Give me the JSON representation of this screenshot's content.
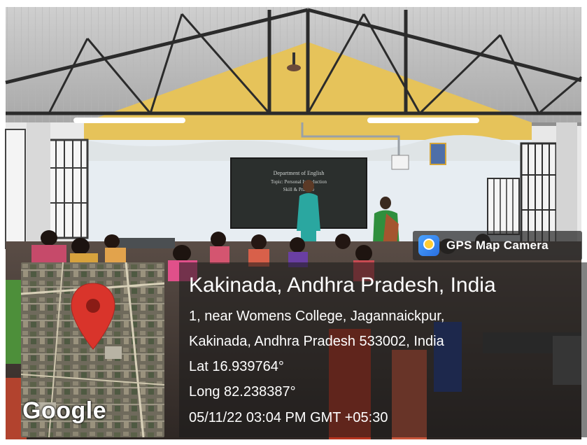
{
  "watermark": {
    "app_name": "GPS Map Camera",
    "logo_icon": "gps-map-camera-icon"
  },
  "location": {
    "title": "Kakinada, Andhra Pradesh, India",
    "address_line1": "1, near Womens College, Jagannaickpur,",
    "address_line2": "Kakinada, Andhra Pradesh 533002, India",
    "lat": "Lat 16.939764°",
    "long": "Long 82.238387°",
    "datetime": "05/11/22 03:04 PM GMT +05:30"
  },
  "map": {
    "brand": "Google",
    "pin_icon": "location-pin-icon",
    "pin_color": "#d9342b"
  },
  "blackboard": {
    "line1": "Department of English",
    "line2": "Topic: Personal Introduction",
    "line3": "Skill & Practice"
  }
}
